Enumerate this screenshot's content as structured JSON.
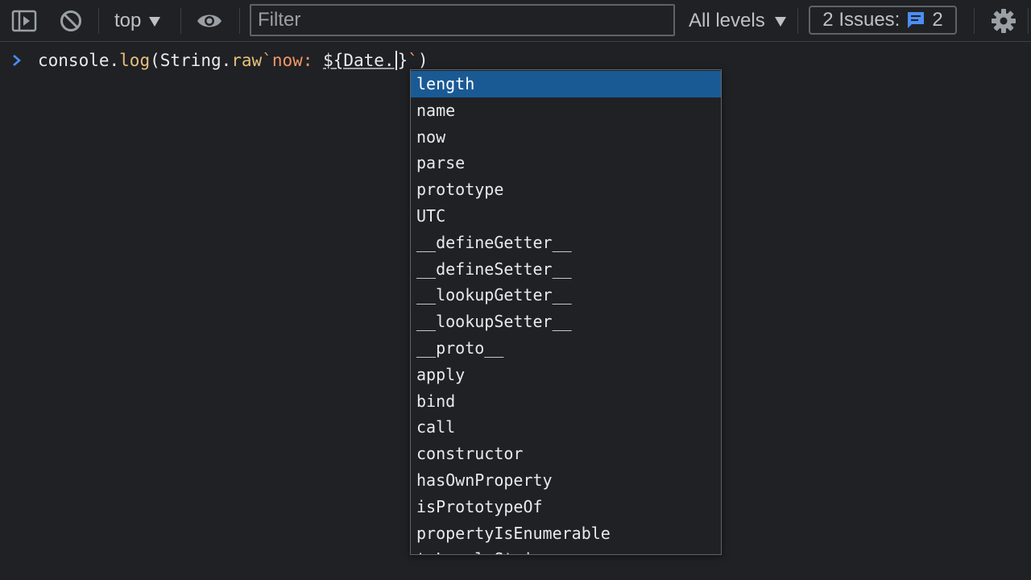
{
  "toolbar": {
    "context": "top",
    "filter_placeholder": "Filter",
    "levels": "All levels",
    "issues_label": "2 Issues:",
    "issues_count": "2",
    "icons": {
      "sidebar": "sidebar-toggle-icon",
      "clear": "clear-console-icon",
      "eye": "live-expression-eye-icon",
      "issues": "issues-message-icon",
      "settings": "gear-icon"
    }
  },
  "console": {
    "input": {
      "code_before": "console.",
      "fn_log": "log",
      "paren_open": "(",
      "obj_string": "String.",
      "fn_raw": "raw",
      "backtick_open": "`",
      "str_now": "now: ",
      "interp": "${Date.",
      "brace_close": "}",
      "backtick_close": "`",
      "paren_close": ")"
    }
  },
  "autocomplete": {
    "selected_index": 0,
    "items": [
      "length",
      "name",
      "now",
      "parse",
      "prototype",
      "UTC",
      "__defineGetter__",
      "__defineSetter__",
      "__lookupGetter__",
      "__lookupSetter__",
      "__proto__",
      "apply",
      "bind",
      "call",
      "constructor",
      "hasOwnProperty",
      "isPrototypeOf",
      "propertyIsEnumerable",
      "toLocaleString"
    ]
  },
  "colors": {
    "background": "#202124",
    "selected": "#1a5a94",
    "accent_blue": "#4c8df6",
    "function_yellow": "#e5c07b",
    "string_orange": "#f29766"
  }
}
